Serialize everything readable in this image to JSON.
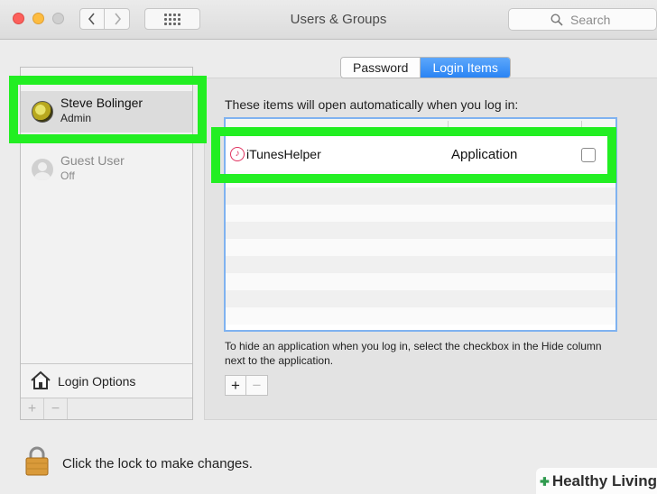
{
  "window": {
    "title": "Users & Groups",
    "search_placeholder": "Search"
  },
  "users": [
    {
      "name": "Steve Bolinger",
      "role": "Admin"
    },
    {
      "name": "Guest User",
      "role": "Off"
    }
  ],
  "sidebar": {
    "login_options_label": "Login Options",
    "add_symbol": "+",
    "remove_symbol": "−"
  },
  "tabs": {
    "password": "Password",
    "login_items": "Login Items"
  },
  "login_items": {
    "intro": "These items will open automatically when you log in:",
    "rows": [
      {
        "name": "iTunesHelper",
        "kind": "Application",
        "hide": false
      }
    ],
    "hint": "To hide an application when you log in, select the checkbox in the Hide column next to the application.",
    "add_symbol": "+",
    "remove_symbol": "−"
  },
  "footer": {
    "lock_text": "Click the lock to make changes."
  },
  "watermark": {
    "text": "Healthy Living"
  },
  "colors": {
    "highlight": "#22ee22",
    "selected_tab": "#2a84f4",
    "table_focus_border": "#7fb2f0"
  }
}
